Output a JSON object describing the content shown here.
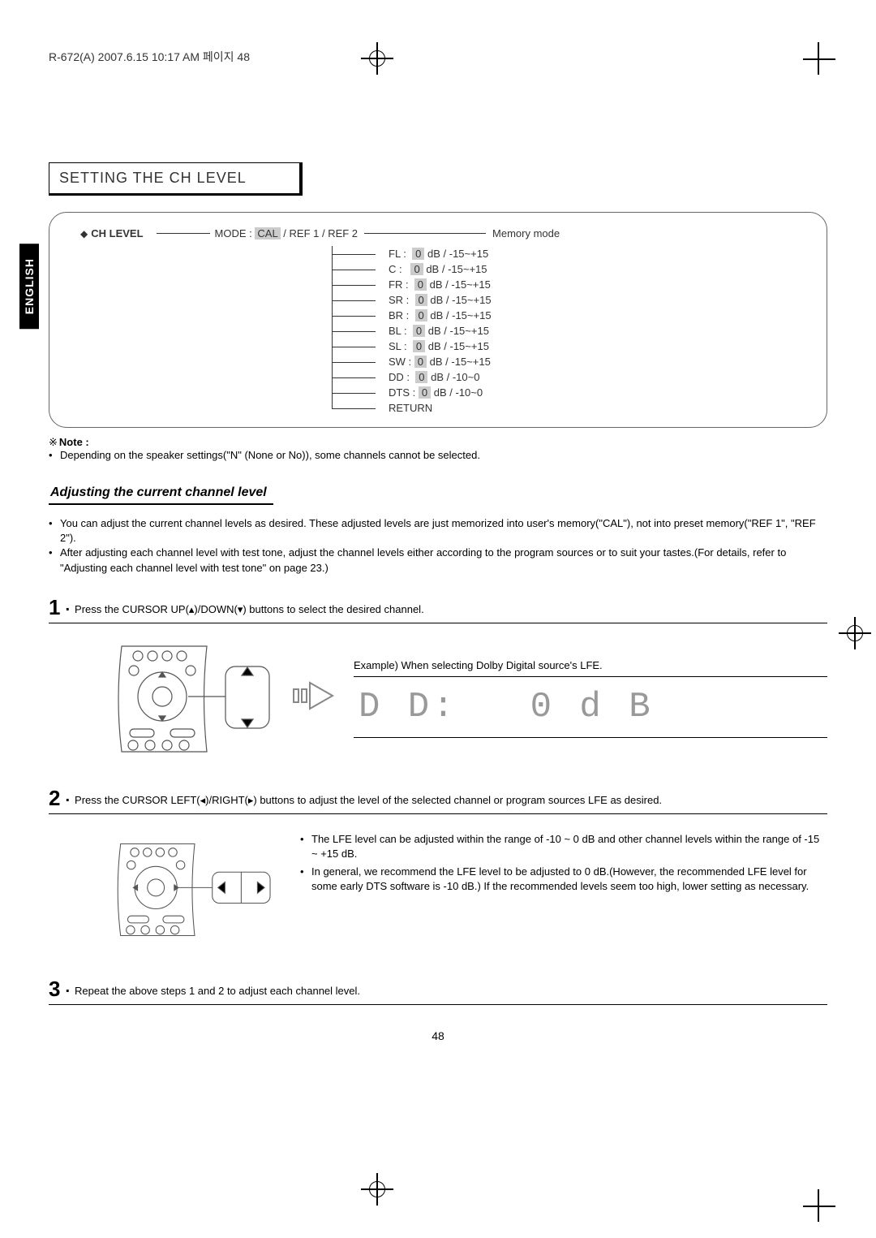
{
  "header": "R-672(A)  2007.6.15  10:17 AM  페이지 48",
  "side_tab": "ENGLISH",
  "section_title": "SETTING THE CH LEVEL",
  "menu": {
    "heading": "CH LEVEL",
    "mode_label": "MODE :",
    "mode_options": "CAL / REF 1 / REF 2",
    "mode_selected": "CAL",
    "memory_label": "Memory mode",
    "items": [
      {
        "label": "FL :",
        "value": "0",
        "range": "dB / -15~+15"
      },
      {
        "label": "C :",
        "value": "0",
        "range": "dB / -15~+15"
      },
      {
        "label": "FR :",
        "value": "0",
        "range": "dB / -15~+15"
      },
      {
        "label": "SR :",
        "value": "0",
        "range": "dB / -15~+15"
      },
      {
        "label": "BR :",
        "value": "0",
        "range": "dB / -15~+15"
      },
      {
        "label": "BL :",
        "value": "0",
        "range": "dB / -15~+15"
      },
      {
        "label": "SL :",
        "value": "0",
        "range": "dB / -15~+15"
      },
      {
        "label": "SW :",
        "value": "0",
        "range": "dB / -15~+15"
      },
      {
        "label": "DD :",
        "value": "0",
        "range": "dB / -10~0"
      },
      {
        "label": "DTS :",
        "value": "0",
        "range": "dB / -10~0"
      }
    ],
    "return": "RETURN"
  },
  "note": {
    "symbol": "※",
    "label": "Note :",
    "text": "Depending on the speaker settings(\"N\" (None or No)), some channels cannot be selected."
  },
  "subheading": "Adjusting the current channel level",
  "intro": {
    "b1": "You can adjust the current channel levels as desired. These adjusted levels are just memorized into user's memory(\"CAL\"), not into preset memory(\"REF 1\", \"REF 2\").",
    "b2": "After adjusting each channel level with test tone, adjust the channel levels either according to the program sources or to suit your tastes.(For details, refer to \"Adjusting each channel level with test tone\" on page 23.)"
  },
  "steps": {
    "s1": "Press the CURSOR UP(▴)/DOWN(▾) buttons to select the desired channel.",
    "s2": "Press the CURSOR LEFT(◂)/RIGHT(▸) buttons to adjust the level of the selected channel or program sources LFE as desired.",
    "s3": "Repeat the above steps 1 and 2 to adjust each channel level."
  },
  "example": {
    "title": "Example) When selecting Dolby Digital source's LFE.",
    "display_left": "D D:",
    "display_right": "0 d B"
  },
  "side_notes": {
    "n1": "The LFE level can be adjusted within the range of -10 ~ 0 dB and other channel levels within the range of -15 ~ +15 dB.",
    "n2": "In general, we recommend the LFE level to be adjusted to 0 dB.(However, the recommended LFE level for some early DTS software is -10 dB.) If the recommended levels seem too high, lower setting as necessary."
  },
  "page_number": "48"
}
